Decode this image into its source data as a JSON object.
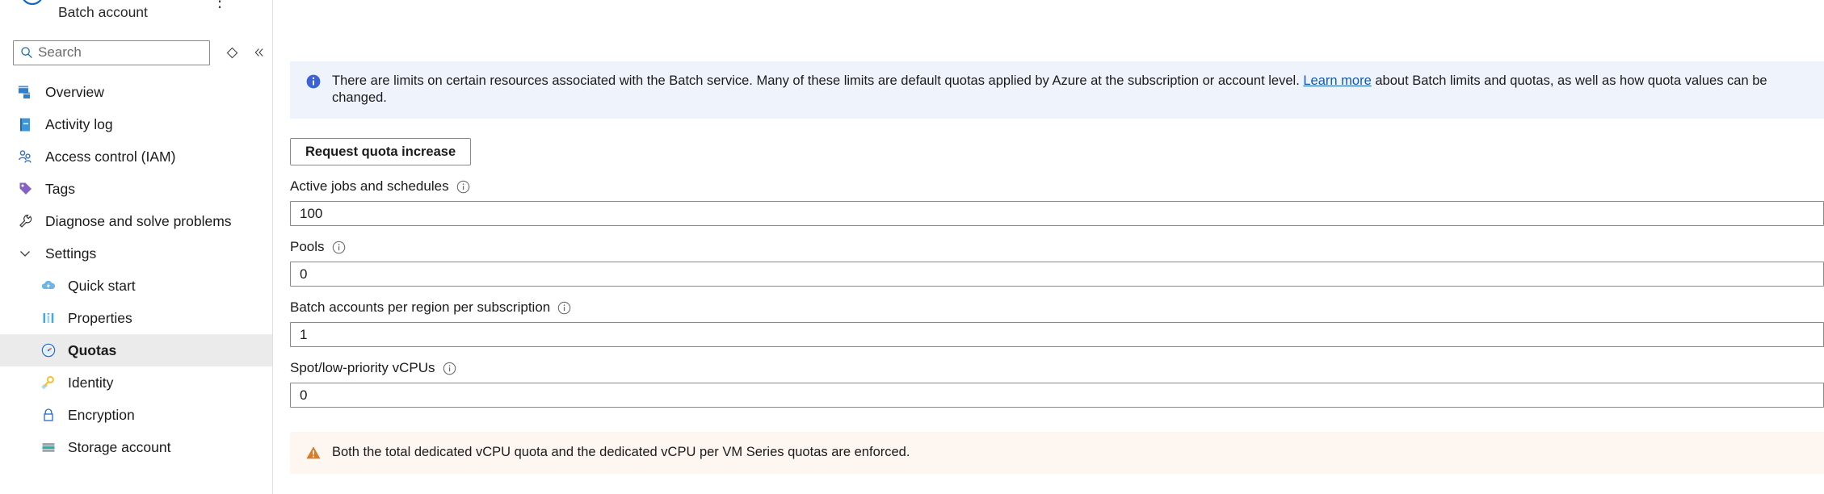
{
  "resource": {
    "subtitle": "Batch account",
    "more_label": "⋮"
  },
  "search": {
    "placeholder": "Search",
    "value": "",
    "icon": "search-icon",
    "pin_icon": "pin-diamond-icon",
    "collapse_icon": "double-chevron-left-icon"
  },
  "sidebar": {
    "items": [
      {
        "label": "Overview",
        "icon": "overview-icon",
        "level": "top",
        "selected": false
      },
      {
        "label": "Activity log",
        "icon": "activity-log-icon",
        "level": "top",
        "selected": false
      },
      {
        "label": "Access control (IAM)",
        "icon": "access-control-icon",
        "level": "top",
        "selected": false
      },
      {
        "label": "Tags",
        "icon": "tag-icon",
        "level": "top",
        "selected": false
      },
      {
        "label": "Diagnose and solve problems",
        "icon": "wrench-icon",
        "level": "top",
        "selected": false
      },
      {
        "label": "Settings",
        "icon": "chevron-down-icon",
        "level": "group",
        "selected": false
      },
      {
        "label": "Quick start",
        "icon": "quick-start-cloud-icon",
        "level": "child",
        "selected": false
      },
      {
        "label": "Properties",
        "icon": "properties-bars-icon",
        "level": "child",
        "selected": false
      },
      {
        "label": "Quotas",
        "icon": "quotas-gauge-icon",
        "level": "child",
        "selected": true
      },
      {
        "label": "Identity",
        "icon": "identity-key-icon",
        "level": "child",
        "selected": false
      },
      {
        "label": "Encryption",
        "icon": "encryption-lock-icon",
        "level": "child",
        "selected": false
      },
      {
        "label": "Storage account",
        "icon": "storage-account-icon",
        "level": "child",
        "selected": false
      }
    ]
  },
  "main": {
    "info_banner": {
      "icon": "info-icon",
      "text_before_link": "There are limits on certain resources associated with the Batch service. Many of these limits are default quotas applied by Azure at the subscription or account level.",
      "link_text": "Learn more",
      "text_after_link": "about Batch limits and quotas, as well as how quota values can be changed."
    },
    "request_button": "Request quota increase",
    "fields": [
      {
        "label": "Active jobs and schedules",
        "value": "100",
        "info_icon": "info-circle-icon"
      },
      {
        "label": "Pools",
        "value": "0",
        "info_icon": "info-circle-icon"
      },
      {
        "label": "Batch accounts per region per subscription",
        "value": "1",
        "info_icon": "info-circle-icon"
      },
      {
        "label": "Spot/low-priority vCPUs",
        "value": "0",
        "info_icon": "info-circle-icon"
      }
    ],
    "warning_banner": {
      "icon": "warning-icon",
      "text": "Both the total dedicated vCPU quota and the dedicated vCPU per VM Series quotas are enforced."
    }
  },
  "colors": {
    "info_banner_bg": "#eff4fc",
    "warning_banner_bg": "#fdf6f1",
    "link": "#0f5bb5",
    "selected_nav_bg": "#ebebeb",
    "border": "#8a8886",
    "azure_blue": "#0078d4",
    "warning_orange": "#d67d29"
  }
}
